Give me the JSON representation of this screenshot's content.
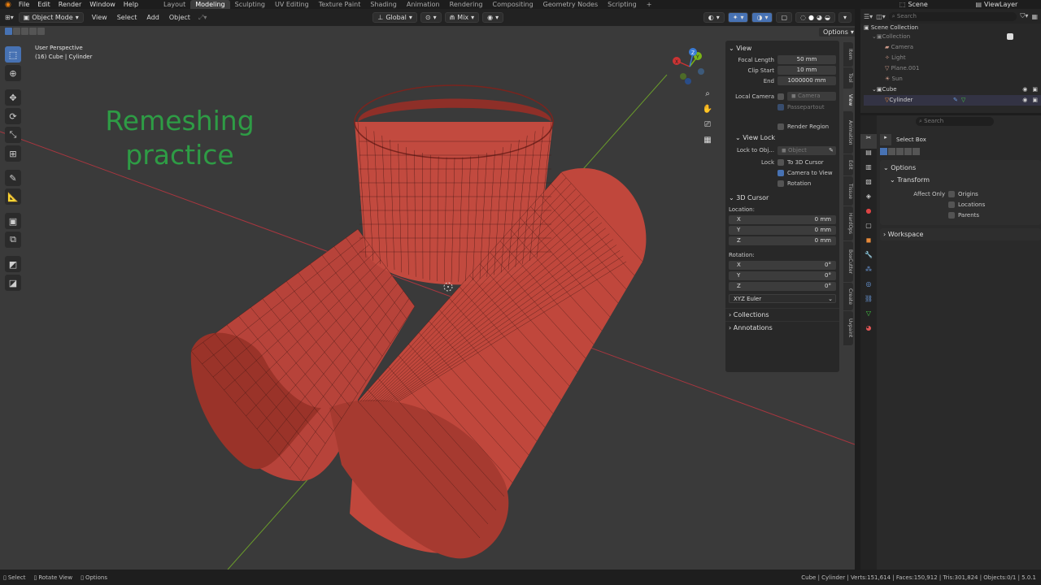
{
  "topbar": {
    "menus": [
      "File",
      "Edit",
      "Render",
      "Window",
      "Help"
    ],
    "workspaces": [
      "Layout",
      "Modeling",
      "Sculpting",
      "UV Editing",
      "Texture Paint",
      "Shading",
      "Animation",
      "Rendering",
      "Compositing",
      "Geometry Nodes",
      "Scripting"
    ],
    "active_workspace": "Modeling",
    "add_tab": "+",
    "scene": "Scene",
    "view_layer": "ViewLayer"
  },
  "vpheader": {
    "mode": "Object Mode",
    "menus": [
      "View",
      "Select",
      "Add",
      "Object"
    ],
    "orientation": "Global",
    "snap": "Mix",
    "options": "Options"
  },
  "viewport": {
    "perspective": "User Perspective",
    "object_path": "(16) Cube | Cylinder",
    "overlay_text_line1": "Remeshing",
    "overlay_text_line2": "practice",
    "overlay_color": "#2e9c45",
    "axes": {
      "x": "X",
      "y": "Y",
      "z": "Z"
    }
  },
  "npanel": {
    "view_title": "View",
    "focal_length_label": "Focal Length",
    "focal_length": "50 mm",
    "clip_start_label": "Clip Start",
    "clip_start": "10 mm",
    "end_label": "End",
    "end": "1000000 mm",
    "local_camera_label": "Local Camera",
    "camera_placeholder": "Camera",
    "passepartout": "Passepartout",
    "render_region": "Render Region",
    "view_lock_title": "View Lock",
    "lock_to_obj_label": "Lock to Obj...",
    "object_placeholder": "Object",
    "lock_label": "Lock",
    "to_3d_cursor": "To 3D Cursor",
    "camera_to_view": "Camera to View",
    "rotation_lock": "Rotation",
    "cursor_title": "3D Cursor",
    "location_label": "Location:",
    "loc_x_label": "X",
    "loc_x": "0 mm",
    "loc_y_label": "Y",
    "loc_y": "0 mm",
    "loc_z_label": "Z",
    "loc_z": "0 mm",
    "rotation_label": "Rotation:",
    "rot_x_label": "X",
    "rot_x": "0°",
    "rot_y_label": "Y",
    "rot_y": "0°",
    "rot_z_label": "Z",
    "rot_z": "0°",
    "euler": "XYZ Euler",
    "collections": "Collections",
    "annotations": "Annotations"
  },
  "vtabs": [
    "Item",
    "Tool",
    "View",
    "Animation",
    "Edit",
    "Tissue",
    "HardOps",
    "BoxCutter",
    "Create",
    "Uvpaint"
  ],
  "outliner": {
    "search_placeholder": "Search",
    "scene_collection": "Scene Collection",
    "collection": "Collection",
    "items": [
      "Camera",
      "Light",
      "Plane.001",
      "Sun"
    ],
    "cube": "Cube",
    "cylinder": "Cylinder"
  },
  "props": {
    "search_placeholder": "Search",
    "tool_name": "Select Box",
    "options": "Options",
    "transform": "Transform",
    "affect_only": "Affect Only",
    "origins": "Origins",
    "locations": "Locations",
    "parents": "Parents",
    "workspace": "Workspace"
  },
  "statusbar": {
    "select": "Select",
    "rotate_view": "Rotate View",
    "options": "Options",
    "stats": "Cube | Cylinder | Verts:151,614 | Faces:150,912 | Tris:301,824 | Objects:0/1 | 5.0.1"
  },
  "colors": {
    "accent": "#4772b3",
    "mesh": "#c0473c",
    "mesh_dark": "#7a241e",
    "x_axis": "#a8363f",
    "y_axis": "#6a9c2b",
    "wire": "#3a1512"
  }
}
